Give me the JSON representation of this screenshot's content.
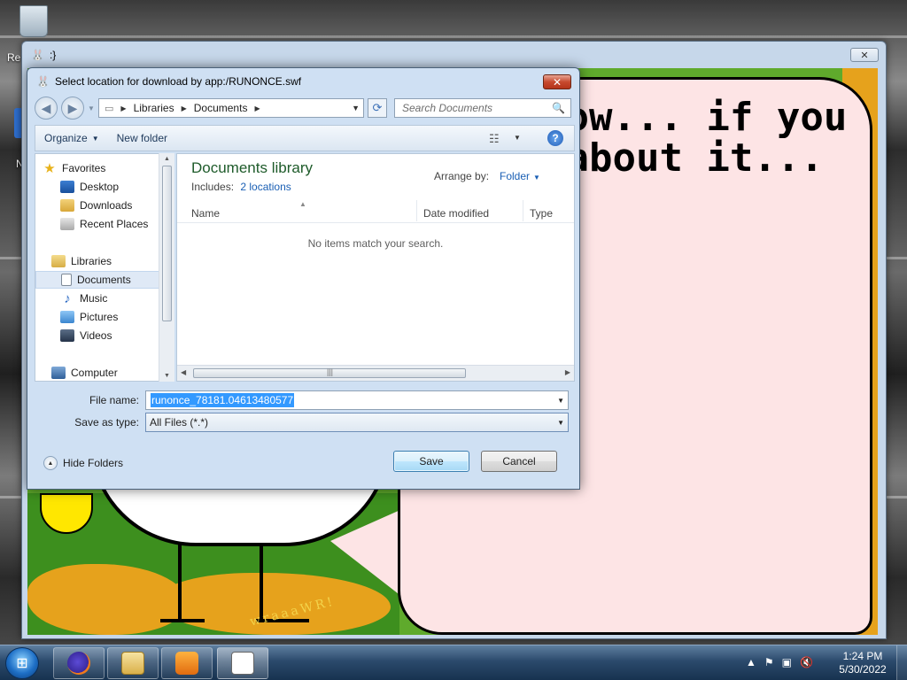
{
  "desktop": {
    "recycle_bin_label": "Re",
    "side_label": "N"
  },
  "app_window": {
    "title": ":}",
    "close_label": "✕",
    "speech_text": "now... if you\n about it..."
  },
  "dialog": {
    "title": "Select location for download by app:/RUNONCE.swf",
    "close_label": "✕",
    "breadcrumb": [
      "Libraries",
      "Documents"
    ],
    "search_placeholder": "Search Documents",
    "toolbar": {
      "organize_label": "Organize",
      "new_folder_label": "New folder"
    },
    "nav": {
      "favorites": "Favorites",
      "desktop": "Desktop",
      "downloads": "Downloads",
      "recent_places": "Recent Places",
      "libraries": "Libraries",
      "documents": "Documents",
      "music": "Music",
      "pictures": "Pictures",
      "videos": "Videos",
      "computer": "Computer"
    },
    "library": {
      "title": "Documents library",
      "includes_label": "Includes:",
      "includes_link": "2 locations",
      "arrange_label": "Arrange by:",
      "arrange_value": "Folder"
    },
    "columns": {
      "name": "Name",
      "date_modified": "Date modified",
      "type": "Type"
    },
    "empty_message": "No items match your search.",
    "file_name_label": "File name:",
    "file_name_value": "runonce_78181.04613480577",
    "save_type_label": "Save as type:",
    "save_type_value": "All Files (*.*)",
    "hide_folders_label": "Hide Folders",
    "save_label": "Save",
    "cancel_label": "Cancel"
  },
  "taskbar": {
    "time": "1:24 PM",
    "date": "5/30/2022",
    "start_label": "⊞"
  }
}
